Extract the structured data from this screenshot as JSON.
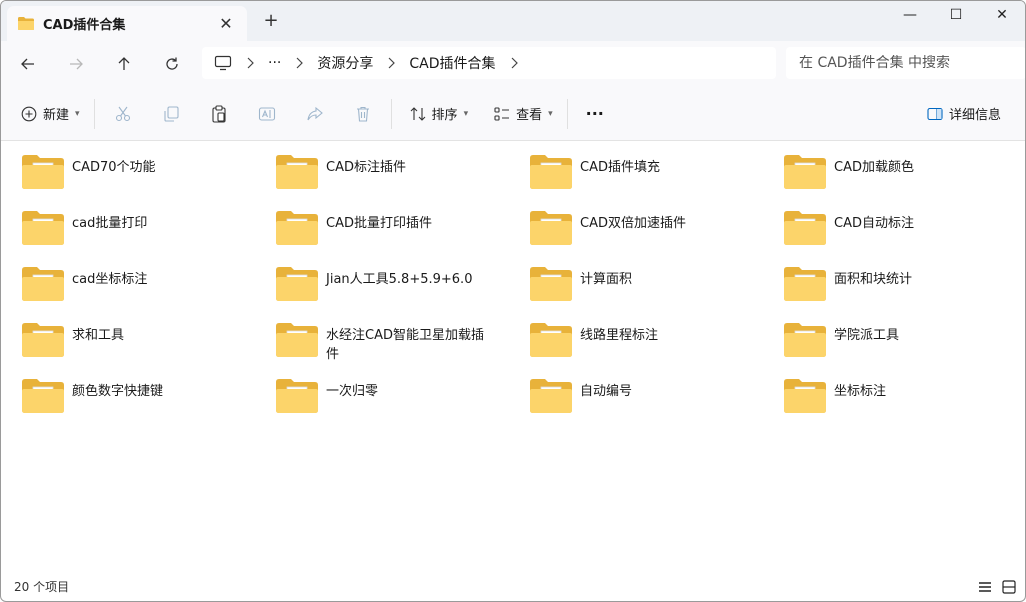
{
  "window": {
    "tab_title": "CAD插件合集",
    "tab_close": "✕",
    "new_tab": "+",
    "minimize": "—",
    "maximize": "☐",
    "close": "✕"
  },
  "nav": {
    "back_icon": "arrow-left-icon",
    "forward_icon": "arrow-right-icon",
    "up_icon": "arrow-up-icon",
    "refresh_icon": "refresh-icon"
  },
  "address": {
    "more": "···",
    "crumbs": [
      "资源分享",
      "CAD插件合集"
    ]
  },
  "search": {
    "placeholder": "在 CAD插件合集 中搜索"
  },
  "toolbar": {
    "new_label": "新建",
    "sort_label": "排序",
    "view_label": "查看",
    "more_label": "···",
    "details_label": "详细信息"
  },
  "items": [
    "CAD70个功能",
    "CAD标注插件",
    "CAD插件填充",
    "CAD加载颜色",
    "cad批量打印",
    "CAD批量打印插件",
    "CAD双倍加速插件",
    "CAD自动标注",
    "cad坐标标注",
    "Jian人工具5.8+5.9+6.0",
    "计算面积",
    "面积和块统计",
    "求和工具",
    "水经注CAD智能卫星加载插件",
    "线路里程标注",
    "学院派工具",
    "颜色数字快捷键",
    "一次归零",
    "自动编号",
    "坐标标注"
  ],
  "status": {
    "count": "20 个项目"
  },
  "colors": {
    "folder_back": "#e8b23a",
    "folder_front": "#fcd46a",
    "accent": "#0067c0"
  }
}
